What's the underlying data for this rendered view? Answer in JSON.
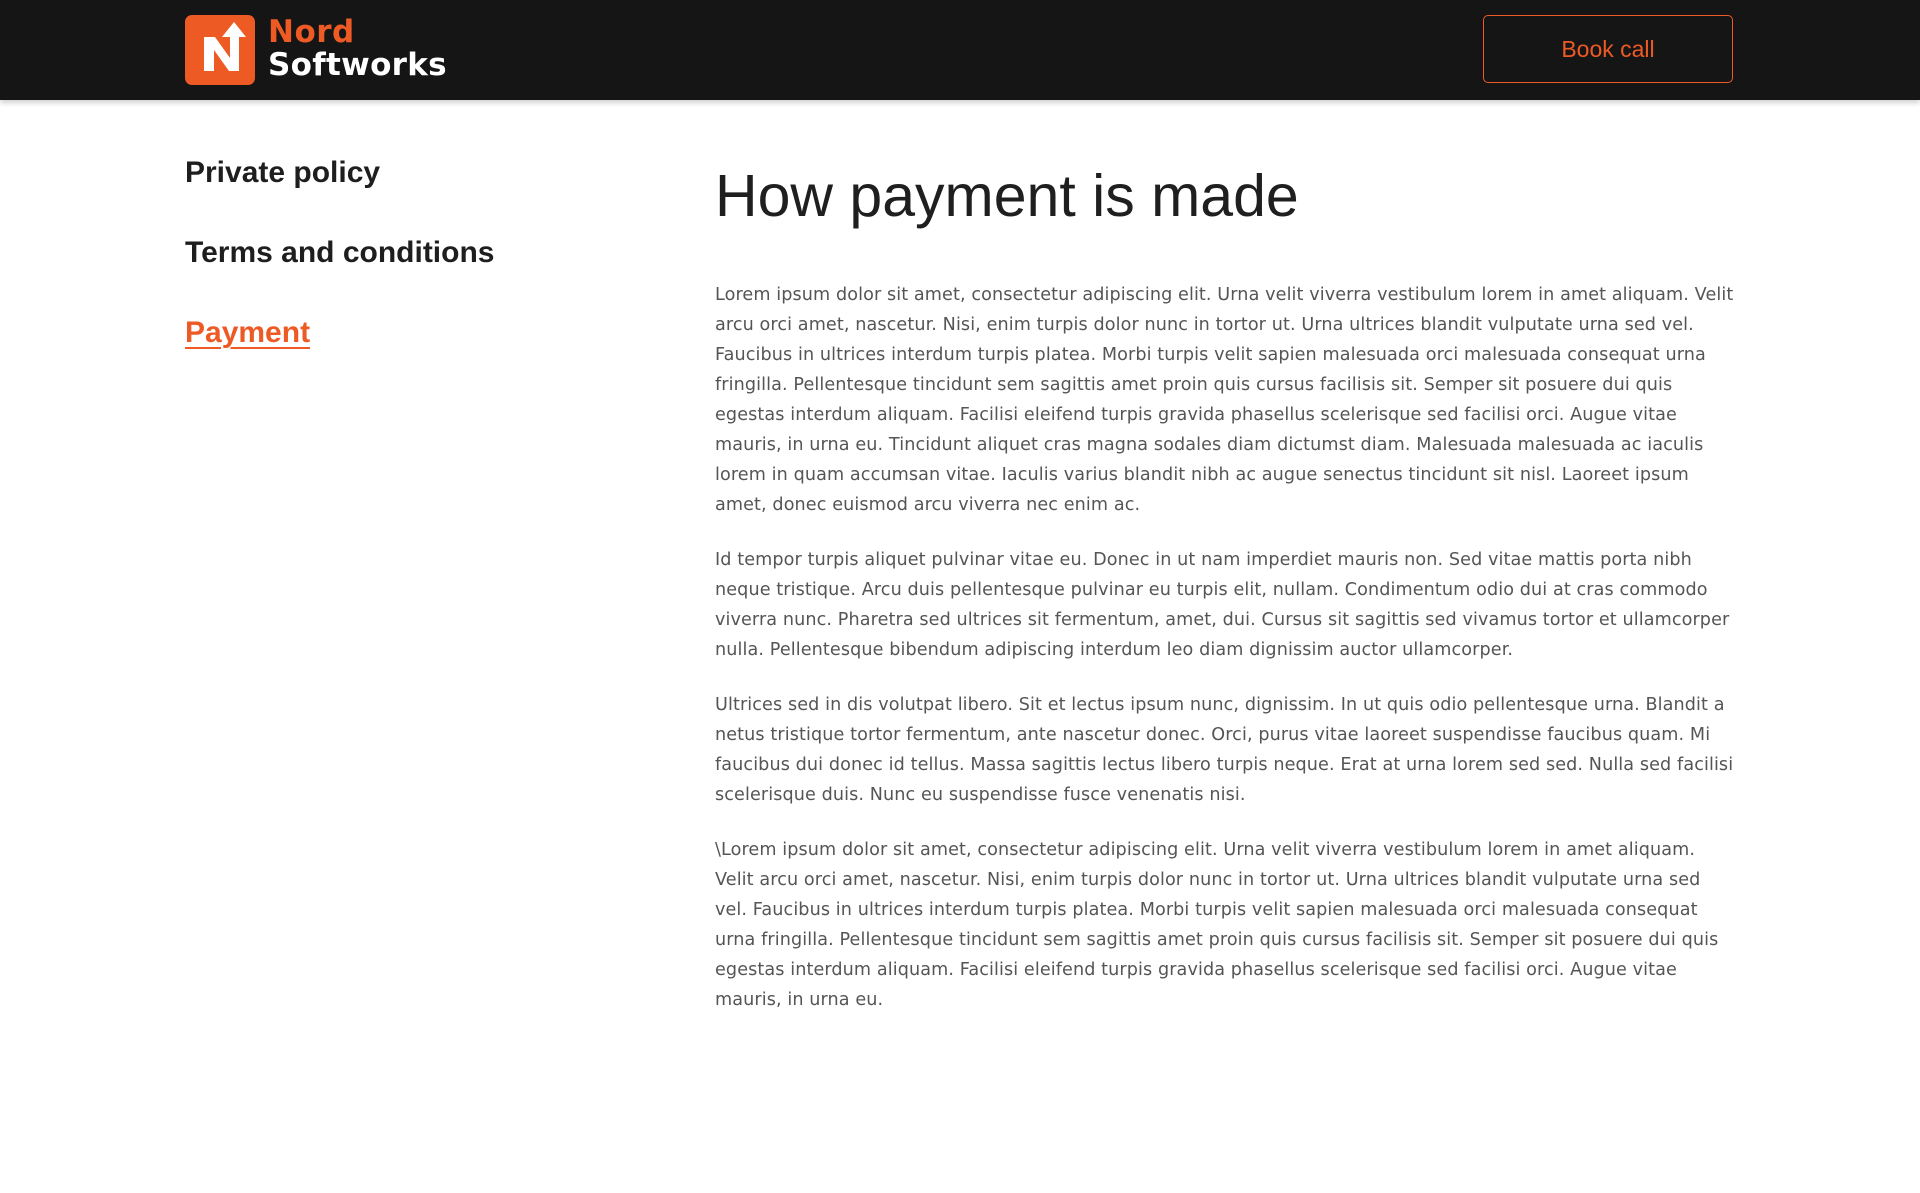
{
  "header": {
    "logo": {
      "line1": "Nord",
      "line2": "Softworks",
      "icon": "nord-arrow-logo-icon",
      "accent": "#ee5a24"
    },
    "book_call_label": "Book call",
    "background": "#151515"
  },
  "sidebar": {
    "items": [
      {
        "label": "Private policy",
        "active": false
      },
      {
        "label": "Terms and conditions",
        "active": false
      },
      {
        "label": "Payment",
        "active": true
      }
    ]
  },
  "main": {
    "title": "How payment is made",
    "paragraphs": [
      "Lorem ipsum dolor sit amet, consectetur adipiscing elit. Urna velit viverra vestibulum lorem in amet aliquam. Velit arcu orci amet, nascetur. Nisi, enim turpis dolor nunc in tortor ut. Urna ultrices blandit vulputate urna sed vel. Faucibus in ultrices interdum turpis platea. Morbi turpis velit sapien malesuada orci malesuada consequat urna fringilla. Pellentesque tincidunt sem sagittis amet proin quis cursus facilisis sit. Semper sit posuere dui quis egestas interdum aliquam. Facilisi eleifend turpis gravida phasellus scelerisque sed facilisi orci. Augue vitae mauris, in urna eu. Tincidunt aliquet cras magna sodales diam dictumst diam. Malesuada malesuada ac iaculis lorem in quam accumsan vitae. Iaculis varius blandit nibh ac augue senectus tincidunt sit nisl. Laoreet ipsum amet, donec euismod arcu viverra nec enim ac.",
      "Id tempor turpis aliquet pulvinar vitae eu. Donec in ut nam imperdiet mauris non. Sed vitae mattis porta nibh neque tristique. Arcu duis pellentesque pulvinar eu turpis elit, nullam. Condimentum odio dui at cras commodo viverra nunc. Pharetra sed ultrices sit fermentum, amet, dui. Cursus sit sagittis sed vivamus tortor et ullamcorper nulla. Pellentesque bibendum adipiscing interdum leo diam dignissim auctor ullamcorper.",
      "Ultrices sed in dis volutpat libero. Sit et lectus ipsum nunc, dignissim. In ut quis odio pellentesque urna. Blandit a netus tristique tortor fermentum, ante nascetur donec. Orci, purus vitae laoreet suspendisse faucibus quam. Mi faucibus dui donec id tellus. Massa sagittis lectus libero turpis neque. Erat at urna lorem sed sed. Nulla sed facilisi scelerisque duis. Nunc eu suspendisse fusce venenatis nisi.",
      "\\Lorem ipsum dolor sit amet, consectetur adipiscing elit. Urna velit viverra vestibulum lorem in amet aliquam. Velit arcu orci amet, nascetur. Nisi, enim turpis dolor nunc in tortor ut. Urna ultrices blandit vulputate urna sed vel. Faucibus in ultrices interdum turpis platea. Morbi turpis velit sapien malesuada orci malesuada consequat urna fringilla. Pellentesque tincidunt sem sagittis amet proin quis cursus facilisis sit. Semper sit posuere dui quis egestas interdum aliquam. Facilisi eleifend turpis gravida phasellus scelerisque sed facilisi orci. Augue vitae mauris, in urna eu."
    ]
  }
}
